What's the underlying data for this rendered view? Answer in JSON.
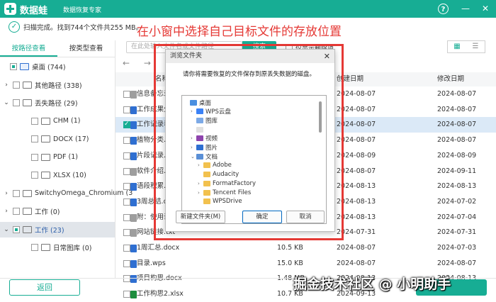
{
  "app": {
    "name": "数据蛙",
    "subtitle": "数据恢复专家",
    "help": "?",
    "minimize": "—",
    "close": "✕"
  },
  "scan": {
    "check": "✓",
    "status": "扫描完成。找到744个文件共255 MB。"
  },
  "annotation": "在小窗中选择自己目标文件的存放位置",
  "tabs": [
    "按路径查看",
    "按类型查看"
  ],
  "tree": [
    {
      "label": "桌面 (744)",
      "indent": 0,
      "chev": "",
      "cb": "partial",
      "folder": "blue"
    },
    {
      "label": "其他路径 (338)",
      "indent": 1,
      "chev": "›",
      "cb": "",
      "folder": "plain"
    },
    {
      "label": "丢失路径 (29)",
      "indent": 1,
      "chev": "⌄",
      "cb": "",
      "folder": "plain"
    },
    {
      "label": "CHM (1)",
      "indent": 2,
      "chev": "",
      "cb": "",
      "folder": "plain"
    },
    {
      "label": "DOCX (17)",
      "indent": 2,
      "chev": "",
      "cb": "",
      "folder": "plain"
    },
    {
      "label": "PDF (1)",
      "indent": 2,
      "chev": "",
      "cb": "",
      "folder": "plain"
    },
    {
      "label": "XLSX (10)",
      "indent": 2,
      "chev": "",
      "cb": "",
      "folder": "plain"
    },
    {
      "label": "SwitchyOmega_Chromium (3",
      "indent": 1,
      "chev": "›",
      "cb": "",
      "folder": "plain"
    },
    {
      "label": "工作 (0)",
      "indent": 1,
      "chev": "›",
      "cb": "",
      "folder": "plain"
    },
    {
      "label": "工作 (23)",
      "indent": 1,
      "chev": "⌄",
      "cb": "partial",
      "folder": "plain",
      "selected": true
    },
    {
      "label": "日常图库 (0)",
      "indent": 2,
      "chev": "",
      "cb": "",
      "folder": "plain"
    }
  ],
  "search": {
    "placeholder": "在此处输入文件名或文件路径",
    "button": "搜索",
    "only_lost": "仅显示删除项"
  },
  "view_buttons": [
    "▦",
    "☰"
  ],
  "nav": {
    "back": "←",
    "forward": "→"
  },
  "columns": {
    "name": "名称",
    "size": "大小",
    "created": "创建日期",
    "modified": "修改日期"
  },
  "files": [
    {
      "name": "信息备忘录.txt",
      "size": "",
      "created": "2024-08-07",
      "modified": "2024-08-07",
      "icon": "#9e9e9e",
      "checked": false
    },
    {
      "name": "工作成果分析.docx",
      "size": "",
      "created": "2024-08-07",
      "modified": "2024-08-07",
      "icon": "#2f6fd1",
      "checked": false
    },
    {
      "name": "工作记录表.docx",
      "size": "",
      "created": "2024-08-07",
      "modified": "2024-08-07",
      "icon": "#2f6fd1",
      "checked": true
    },
    {
      "name": "植物分类.docx",
      "size": "",
      "created": "2024-08-07",
      "modified": "2024-08-07",
      "icon": "#2f6fd1",
      "checked": false
    },
    {
      "name": "片段记录.docx",
      "size": "",
      "created": "2024-08-09",
      "modified": "2024-08-09",
      "icon": "#2f6fd1",
      "checked": false
    },
    {
      "name": "软件介绍.txt",
      "size": "",
      "created": "2024-08-07",
      "modified": "2024-09-11",
      "icon": "#9e9e9e",
      "checked": false
    },
    {
      "name": "语段积累.docx",
      "size": "",
      "created": "2024-08-13",
      "modified": "2024-08-13",
      "icon": "#2f6fd1",
      "checked": false
    },
    {
      "name": "3周总结.docx",
      "size": "",
      "created": "2024-08-13",
      "modified": "2024-07-02",
      "icon": "#2f6fd1",
      "checked": false
    },
    {
      "name": "附：使用说明.txt",
      "size": "",
      "created": "2024-08-13",
      "modified": "2024-07-04",
      "icon": "#9e9e9e",
      "checked": false
    },
    {
      "name": "网站链接.txt",
      "size": "",
      "created": "2024-07-31",
      "modified": "2024-07-31",
      "icon": "#9e9e9e",
      "checked": false
    },
    {
      "name": "1周汇总.docx",
      "size": "10.5 KB",
      "created": "2024-08-07",
      "modified": "2024-07-03",
      "icon": "#2f6fd1",
      "checked": false
    },
    {
      "name": "目录.wps",
      "size": "15.0 KB",
      "created": "2024-08-07",
      "modified": "2024-08-07",
      "icon": "#2f6fd1",
      "checked": false
    },
    {
      "name": "项目构思.docx",
      "size": "1.48 MB",
      "created": "2024-08-13",
      "modified": "2024-08-13",
      "icon": "#2f6fd1",
      "checked": false
    },
    {
      "name": "工作构思2.xlsx",
      "size": "10.7 KB",
      "created": "2024-09-13",
      "modified": "2024-09-13",
      "icon": "#1e8e3e",
      "checked": false
    }
  ],
  "dialog": {
    "title": "浏览文件夹",
    "close": "✕",
    "message": "请你将需要恢复的文件保存到原丢失数据的磁盘。",
    "tree": [
      {
        "label": "桌面",
        "indent": 0,
        "chev": "",
        "icon": "#4a8fe0"
      },
      {
        "label": "WPS云盘",
        "indent": 1,
        "chev": "›",
        "icon": "#3b82f6"
      },
      {
        "label": "图库",
        "indent": 1,
        "chev": "",
        "icon": "#7ca9e6"
      },
      {
        "label": "",
        "indent": 1,
        "chev": "",
        "icon": "#e0e0e0"
      },
      {
        "label": "视频",
        "indent": 1,
        "chev": "›",
        "icon": "#8e44ad"
      },
      {
        "label": "图片",
        "indent": 1,
        "chev": "›",
        "icon": "#2f6fd1"
      },
      {
        "label": "文档",
        "indent": 1,
        "chev": "⌄",
        "icon": "#5a8fd6"
      },
      {
        "label": "Adobe",
        "indent": 2,
        "chev": "›",
        "icon": "#f2c14e"
      },
      {
        "label": "Audacity",
        "indent": 2,
        "chev": "",
        "icon": "#f2c14e"
      },
      {
        "label": "FormatFactory",
        "indent": 2,
        "chev": "›",
        "icon": "#f2c14e"
      },
      {
        "label": "Tencent Files",
        "indent": 2,
        "chev": "›",
        "icon": "#f2c14e"
      },
      {
        "label": "WPSDrive",
        "indent": 2,
        "chev": "",
        "icon": "#f2c14e"
      }
    ],
    "new_folder": "新建文件夹(M)",
    "ok": "确定",
    "cancel": "取消"
  },
  "footer": {
    "back": "返回",
    "watermark": "掘金技术社区 @ 小明助手"
  },
  "colors": {
    "accent": "#17ad94",
    "annotation": "#e53935"
  }
}
